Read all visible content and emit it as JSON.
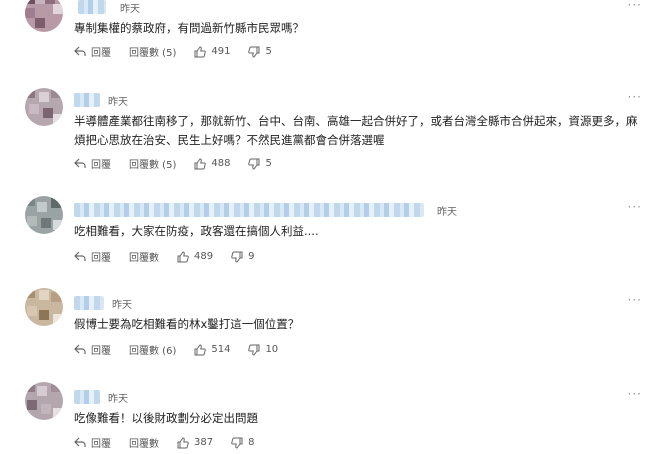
{
  "comments": [
    {
      "time": "昨天",
      "text": "專制集權的蔡政府，有問過新竹縣市民眾嗎？",
      "reply_label": "回覆",
      "replies_label": "回覆數 (5)",
      "likes": "491",
      "dislikes": "5"
    },
    {
      "time": "昨天",
      "text": "半導體產業都往南移了，那就新竹、台中、台南、高雄一起合併好了，或者台灣全縣市合併起來，資源更多，麻煩把心思放在治安、民生上好嗎？不然民進黨都會合併落選喔",
      "reply_label": "回覆",
      "replies_label": "回覆數 (5)",
      "likes": "488",
      "dislikes": "5"
    },
    {
      "time": "昨天",
      "text": "吃相難看，大家在防疫，政客還在搞個人利益....",
      "reply_label": "回覆",
      "replies_label": "回覆數",
      "likes": "489",
      "dislikes": "9"
    },
    {
      "time": "昨天",
      "text": "假博士要為吃相難看的林x鑿打這一個位置？",
      "reply_label": "回覆",
      "replies_label": "回覆數 (6)",
      "likes": "514",
      "dislikes": "10"
    },
    {
      "time": "昨天",
      "text": "吃像難看！以後財政劃分必定出問題",
      "reply_label": "回覆",
      "replies_label": "回覆數",
      "likes": "387",
      "dislikes": "8"
    }
  ]
}
